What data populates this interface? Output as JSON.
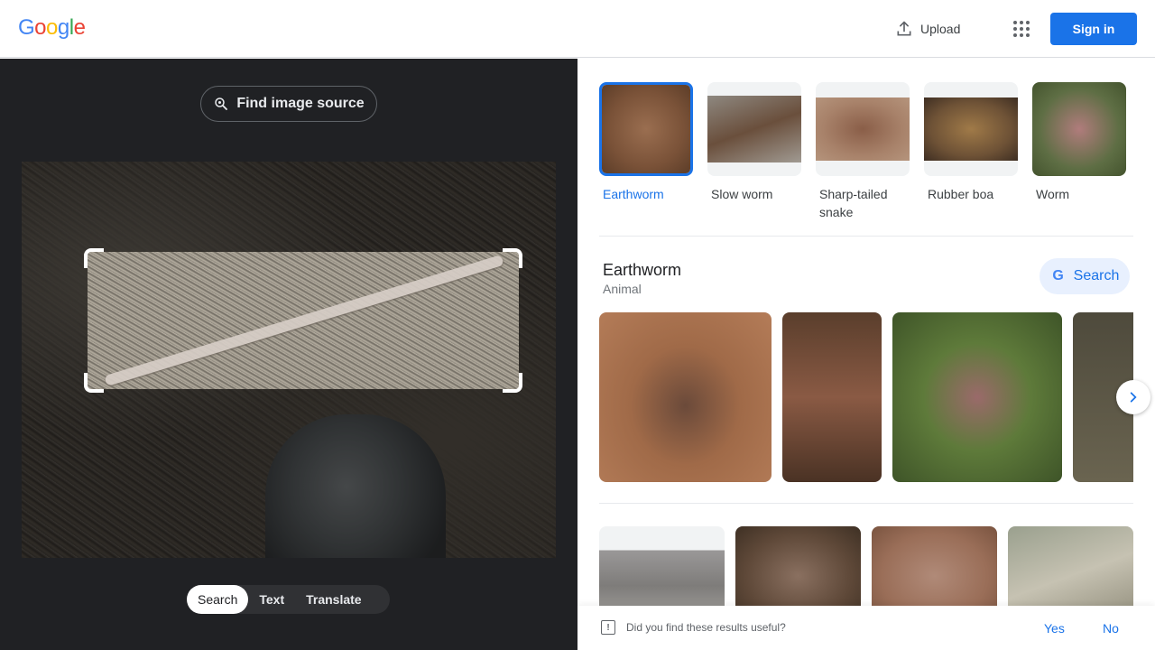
{
  "header": {
    "logo_letters": [
      "G",
      "o",
      "o",
      "g",
      "l",
      "e"
    ],
    "upload_label": "Upload",
    "signin_label": "Sign in"
  },
  "left_panel": {
    "find_source_label": "Find image source",
    "mode_tabs": [
      {
        "label": "Search",
        "active": true
      },
      {
        "label": "Text",
        "active": false
      },
      {
        "label": "Translate",
        "active": false
      }
    ]
  },
  "results": {
    "related_thumbnails": [
      {
        "label": "Earthworm",
        "selected": true
      },
      {
        "label": "Slow worm",
        "selected": false
      },
      {
        "label": "Sharp-tailed snake",
        "selected": false
      },
      {
        "label": "Rubber boa",
        "selected": false
      },
      {
        "label": "Worm",
        "selected": false
      }
    ],
    "entity": {
      "title": "Earthworm",
      "subtitle": "Animal",
      "search_label": "Search"
    }
  },
  "feedback": {
    "question": "Did you find these results useful?",
    "yes_label": "Yes",
    "no_label": "No"
  },
  "colors": {
    "accent": "#1a73e8",
    "dark_panel": "#202124"
  }
}
